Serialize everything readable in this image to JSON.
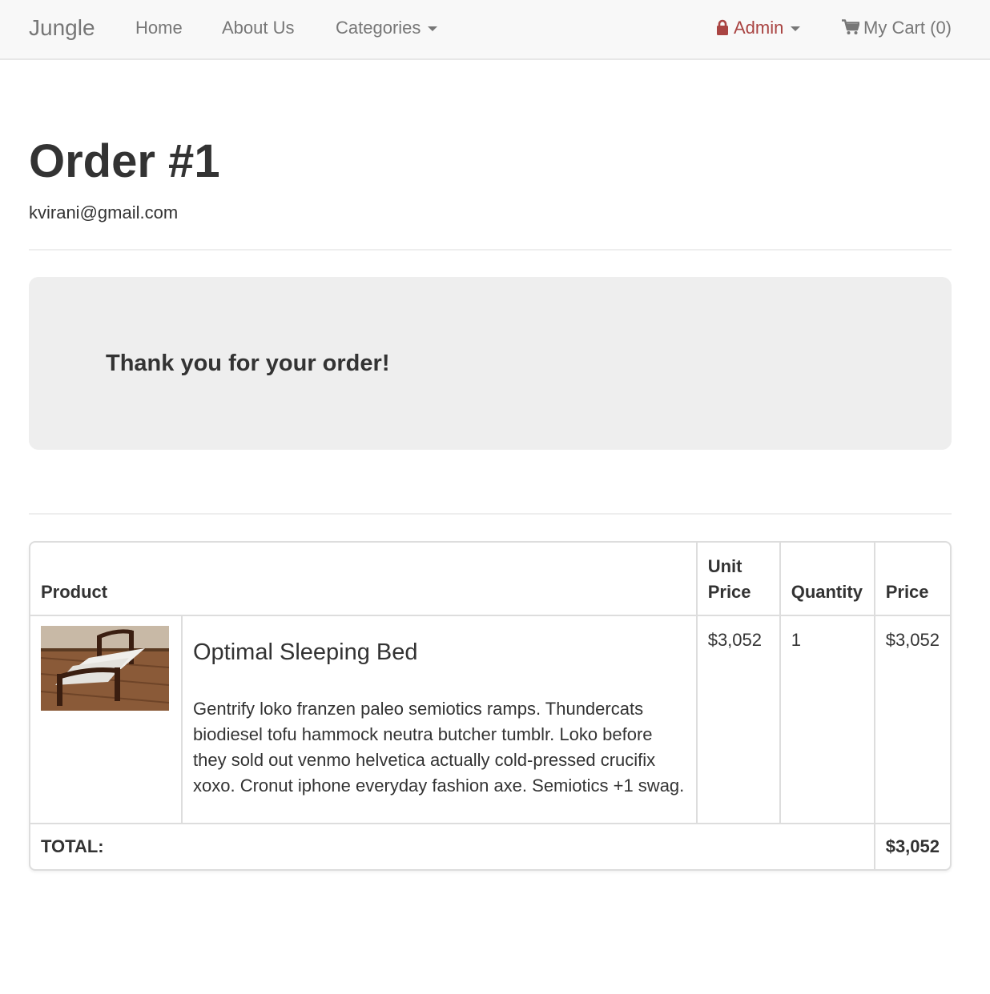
{
  "navbar": {
    "brand": "Jungle",
    "links": [
      "Home",
      "About Us",
      "Categories"
    ],
    "admin_label": "Admin",
    "cart_label": "My Cart (0)",
    "admin_color": "#a94442",
    "icons": [
      "caret-down-icon",
      "lock-icon",
      "cart-icon"
    ]
  },
  "order": {
    "title": "Order #1",
    "email": "kvirani@gmail.com",
    "thank_you": "Thank you for your order!"
  },
  "table": {
    "headers": {
      "product": "Product",
      "unit_price_line1": "Unit",
      "unit_price_line2": "Price",
      "quantity": "Quantity",
      "price": "Price"
    },
    "rows": [
      {
        "name": "Optimal Sleeping Bed",
        "description": "Gentrify loko franzen paleo semiotics ramps. Thundercats biodiesel tofu hammock neutra butcher tumblr. Loko before they sold out venmo helvetica actually cold-pressed crucifix xoxo. Cronut iphone everyday fashion axe. Semiotics +1 swag.",
        "unit_price": "$3,052",
        "quantity": "1",
        "price": "$3,052"
      }
    ],
    "total_label": "TOTAL:",
    "total_value": "$3,052"
  }
}
